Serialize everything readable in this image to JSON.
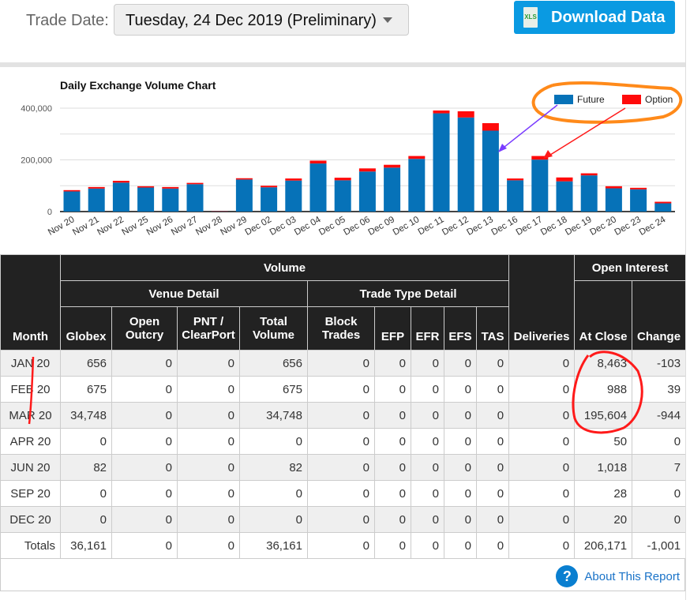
{
  "header": {
    "trade_date_label": "Trade Date:",
    "trade_date_value": "Tuesday, 24 Dec 2019 (Preliminary)",
    "download_label": "Download Data",
    "download_icon_text": "XLS"
  },
  "chart_data": {
    "type": "bar",
    "stacked": true,
    "title": "Daily Exchange Volume Chart",
    "categories": [
      "Nov 20",
      "Nov 21",
      "Nov 22",
      "Nov 25",
      "Nov 26",
      "Nov 27",
      "Nov 28",
      "Nov 29",
      "Dec 02",
      "Dec 03",
      "Dec 04",
      "Dec 05",
      "Dec 06",
      "Dec 09",
      "Dec 10",
      "Dec 11",
      "Dec 12",
      "Dec 13",
      "Dec 16",
      "Dec 17",
      "Dec 18",
      "Dec 19",
      "Dec 20",
      "Dec 23",
      "Dec 24"
    ],
    "series": [
      {
        "name": "Future",
        "color": "#0672b8",
        "values": [
          78000,
          89000,
          112000,
          93000,
          89000,
          106000,
          1000,
          124000,
          94000,
          120000,
          186000,
          121000,
          155000,
          170000,
          204000,
          380000,
          364000,
          313000,
          121000,
          201000,
          117000,
          140000,
          90000,
          86000,
          32000
        ]
      },
      {
        "name": "Option",
        "color": "#ff0a0a",
        "values": [
          5000,
          6000,
          7000,
          5000,
          6000,
          5000,
          1000,
          5000,
          6000,
          8000,
          11000,
          10000,
          12000,
          11000,
          11000,
          11000,
          24000,
          29000,
          7000,
          14000,
          15000,
          8000,
          8000,
          6000,
          6000
        ]
      }
    ],
    "yticks": [
      "0",
      "200,000",
      "400,000"
    ],
    "ylim": [
      0,
      400000
    ],
    "grid": true,
    "legend": "top-right"
  },
  "table": {
    "h_month": "Month",
    "h_volume": "Volume",
    "h_venue": "Venue Detail",
    "h_tradetype": "Trade Type Detail",
    "h_deliveries": "Deliveries",
    "h_oi": "Open Interest",
    "h_globex": "Globex",
    "h_openoutcry": "Open Outcry",
    "h_pnt": "PNT / ClearPort",
    "h_total": "Total Volume",
    "h_block": "Block Trades",
    "h_efp": "EFP",
    "h_efr": "EFR",
    "h_efs": "EFS",
    "h_tas": "TAS",
    "h_atclose": "At Close",
    "h_change": "Change",
    "rows": [
      [
        "JAN 20",
        "656",
        "0",
        "0",
        "656",
        "0",
        "0",
        "0",
        "0",
        "0",
        "0",
        "8,463",
        "-103"
      ],
      [
        "FEB 20",
        "675",
        "0",
        "0",
        "675",
        "0",
        "0",
        "0",
        "0",
        "0",
        "0",
        "988",
        "39"
      ],
      [
        "MAR 20",
        "34,748",
        "0",
        "0",
        "34,748",
        "0",
        "0",
        "0",
        "0",
        "0",
        "0",
        "195,604",
        "-944"
      ],
      [
        "APR 20",
        "0",
        "0",
        "0",
        "0",
        "0",
        "0",
        "0",
        "0",
        "0",
        "0",
        "50",
        "0"
      ],
      [
        "JUN 20",
        "82",
        "0",
        "0",
        "82",
        "0",
        "0",
        "0",
        "0",
        "0",
        "0",
        "1,018",
        "7"
      ],
      [
        "SEP 20",
        "0",
        "0",
        "0",
        "0",
        "0",
        "0",
        "0",
        "0",
        "0",
        "0",
        "28",
        "0"
      ],
      [
        "DEC 20",
        "0",
        "0",
        "0",
        "0",
        "0",
        "0",
        "0",
        "0",
        "0",
        "0",
        "20",
        "0"
      ]
    ],
    "totals": [
      "Totals",
      "36,161",
      "0",
      "0",
      "36,161",
      "0",
      "0",
      "0",
      "0",
      "0",
      "0",
      "206,171",
      "-1,001"
    ]
  },
  "footer": {
    "about_label": "About This Report",
    "about_icon_text": "?"
  }
}
